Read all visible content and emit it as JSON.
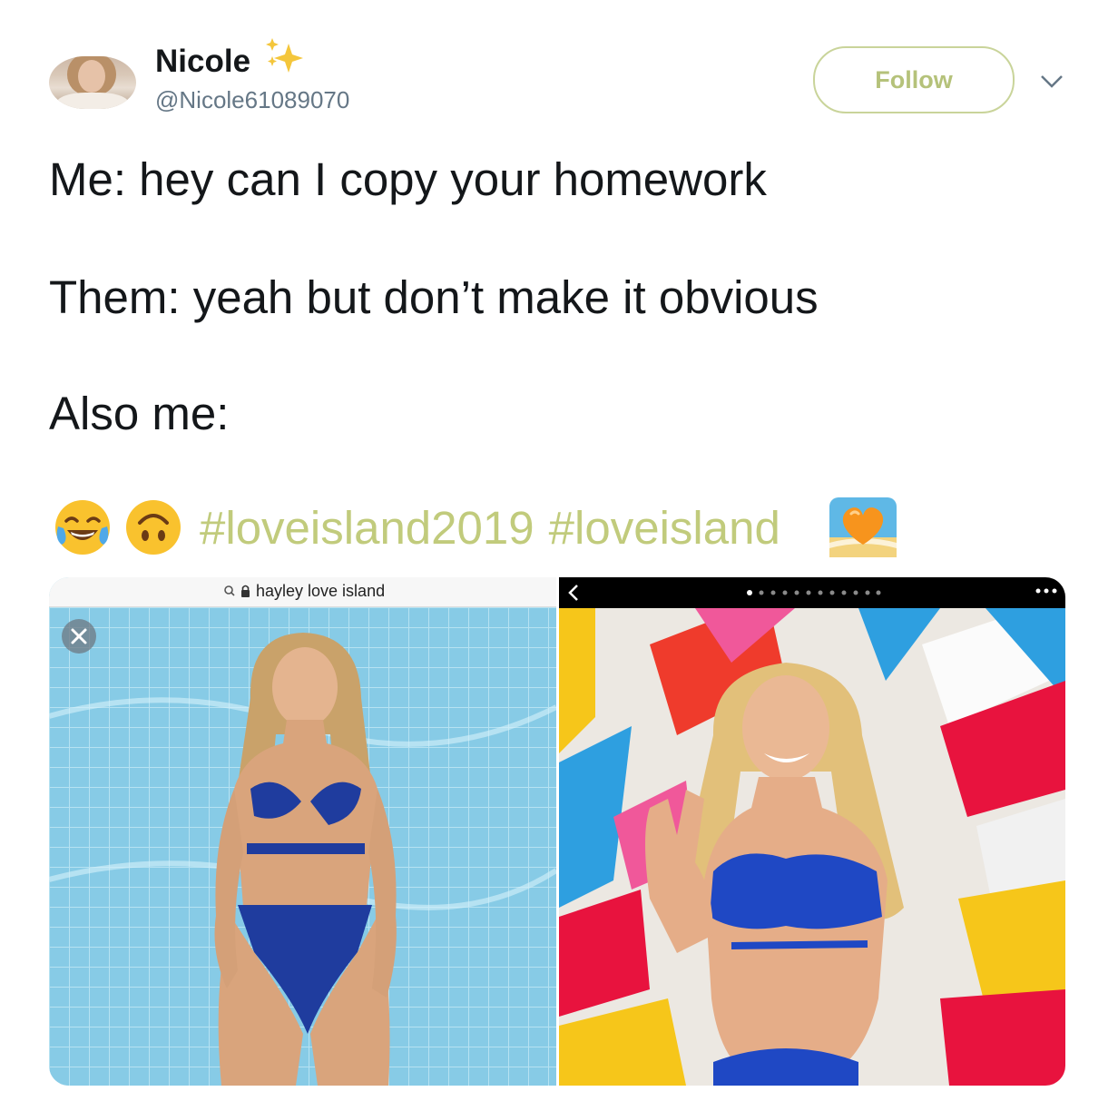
{
  "tweet": {
    "author_name": "Nicole",
    "author_handle": "@Nicole61089070",
    "follow_label": "Follow",
    "lines": [
      "Me: hey can I copy your homework",
      "Them: yeah but don’t make it obvious",
      "Also me:"
    ],
    "hashtags": [
      "#loveisland2019",
      "#loveisland"
    ],
    "emojis": [
      "face-with-tears-of-joy",
      "upside-down-face",
      "orange-heart-on-beach"
    ]
  },
  "media": {
    "left": {
      "search_text": "hayley love island",
      "has_close_button": true
    },
    "right": {
      "carousel_dots": 12,
      "active_dot": 1
    }
  },
  "colors": {
    "text": "#14171a",
    "secondary": "#657786",
    "accent": "#c1cb7c",
    "follow_border": "#c9d49a"
  }
}
